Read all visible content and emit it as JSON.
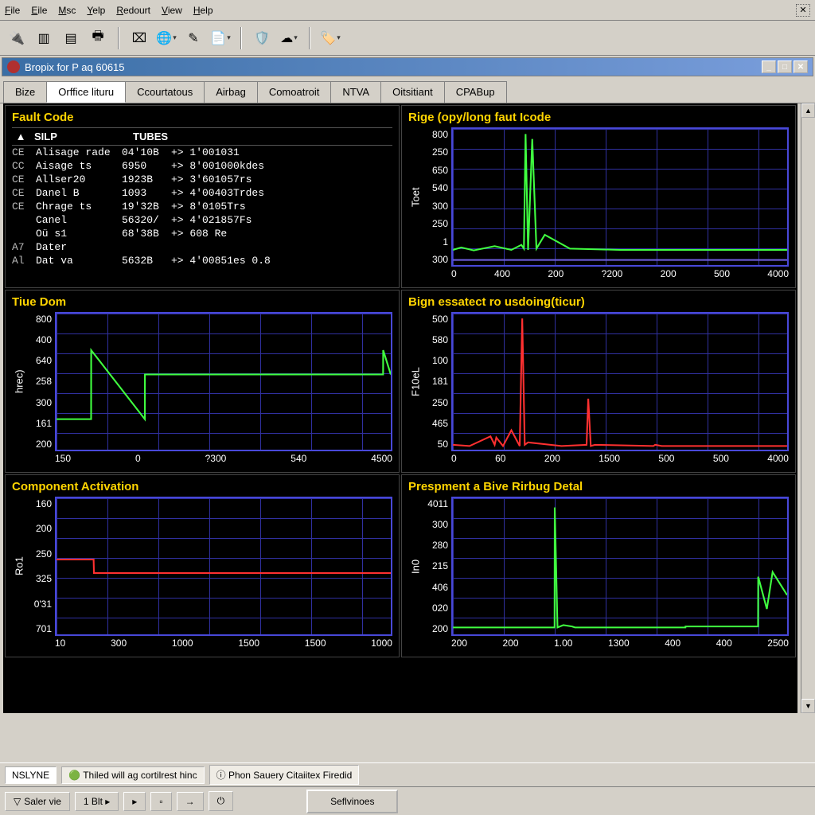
{
  "menu": {
    "file": "File",
    "eile": "Eile",
    "msc": "Msc",
    "yelp": "Yelp",
    "redout": "Redourt",
    "view": "View",
    "help": "Help"
  },
  "child_window_title": "Bropix for P aq 60615",
  "tabs": [
    "Bize",
    "Orffice lituru",
    "Ccourtatous",
    "Airbag",
    "Comoatroit",
    "NTVA",
    "Oitsitiant",
    "CPABup"
  ],
  "active_tab_index": 1,
  "fault_code": {
    "title": "Fault Code",
    "columns": {
      "a": "▲",
      "b": "SILP",
      "c": "TUBES"
    },
    "rows": [
      {
        "c0": "CE",
        "c1": "Alisage rade",
        "c2": "04'10B",
        "c3": "+> 1'001031"
      },
      {
        "c0": "CC",
        "c1": "Aisage ts",
        "c2": "6950",
        "c3": "+> 8'001000kdes"
      },
      {
        "c0": "CE",
        "c1": "Allser20",
        "c2": "1923B",
        "c3": "+> 3'601057rs"
      },
      {
        "c0": "CE",
        "c1": "Danel B",
        "c2": "1093",
        "c3": "+> 4'00403Trdes"
      },
      {
        "c0": "CE",
        "c1": "Chrage ts",
        "c2": "19'32B",
        "c3": "+> 8'0105Trs"
      },
      {
        "c0": "",
        "c1": "Canel",
        "c2": "56320/",
        "c3": "+> 4'021857Fs"
      },
      {
        "c0": "",
        "c1": "Oü s1",
        "c2": "68'38B",
        "c3": "+> 608 Re"
      },
      {
        "c0": "A7",
        "c1": "Dater",
        "c2": "",
        "c3": ""
      },
      {
        "c0": "Al",
        "c1": "Dat va",
        "c2": "5632B",
        "c3": "+> 4'00851es 0.8"
      }
    ]
  },
  "chart_data": [
    {
      "id": "rige",
      "title": "Rige (opy/long faut Icode",
      "type": "line",
      "ylabel": "Toet",
      "yticks": [
        "800",
        "250",
        "650",
        "540",
        "300",
        "250",
        "1",
        "300"
      ],
      "xticks": [
        "0",
        "400",
        "200",
        "?200",
        "200",
        "500",
        "4000"
      ],
      "series": [
        {
          "name": "A",
          "color": "#40ff40",
          "x": [
            0,
            100,
            250,
            500,
            700,
            820,
            850,
            870,
            900,
            950,
            1000,
            1100,
            1400,
            2000,
            3000,
            4000
          ],
          "y": [
            340,
            350,
            338,
            355,
            340,
            360,
            345,
            800,
            340,
            780,
            345,
            400,
            345,
            340,
            340,
            340
          ]
        },
        {
          "name": "B",
          "color": "#7060e0",
          "x": [
            0,
            4000
          ],
          "y": [
            300,
            300
          ]
        }
      ],
      "xlim": [
        0,
        4000
      ],
      "ylim": [
        280,
        820
      ]
    },
    {
      "id": "tiue",
      "title": "Tiue Dom",
      "type": "line",
      "ylabel": "hrec)",
      "yticks": [
        "800",
        "400",
        "640",
        "258",
        "300",
        "161",
        "200"
      ],
      "xticks": [
        "150",
        "0",
        "?300",
        "540",
        "4500"
      ],
      "series": [
        {
          "name": "A",
          "color": "#40ff40",
          "x": [
            150,
            600,
            601,
            1300,
            1301,
            4400,
            4401,
            4500
          ],
          "y": [
            300,
            300,
            640,
            300,
            520,
            520,
            640,
            520
          ]
        }
      ],
      "xlim": [
        150,
        4500
      ],
      "ylim": [
        150,
        820
      ]
    },
    {
      "id": "bign",
      "title": "Bign essatect ro usdoing(ticur)",
      "type": "line",
      "ylabel": "F10eL",
      "yticks": [
        "500",
        "580",
        "100",
        "181",
        "250",
        "465",
        "50"
      ],
      "xticks": [
        "0",
        "60",
        "200",
        "1500",
        "500",
        "500",
        "4000"
      ],
      "series": [
        {
          "name": "A",
          "color": "#ff3030",
          "x": [
            0,
            200,
            450,
            500,
            520,
            600,
            700,
            800,
            830,
            860,
            900,
            1300,
            1600,
            1620,
            1650,
            1700,
            2400,
            2420,
            2500,
            4000
          ],
          "y": [
            60,
            55,
            95,
            60,
            90,
            55,
            120,
            55,
            580,
            60,
            70,
            55,
            60,
            250,
            55,
            60,
            55,
            60,
            55,
            55
          ]
        }
      ],
      "xlim": [
        0,
        4000
      ],
      "ylim": [
        40,
        600
      ]
    },
    {
      "id": "comp",
      "title": "Component Activation",
      "type": "line",
      "ylabel": "Ro1",
      "yticks": [
        "160",
        "200",
        "250",
        "325",
        "0'31",
        "701"
      ],
      "xticks": [
        "10",
        "300",
        "1000",
        "1500",
        "1500",
        "1000"
      ],
      "series": [
        {
          "name": "A",
          "color": "#ff3030",
          "x": [
            10,
            120,
            121,
            1000
          ],
          "y": [
            260,
            260,
            240,
            240
          ]
        }
      ],
      "xlim": [
        10,
        1000
      ],
      "ylim": [
        150,
        350
      ]
    },
    {
      "id": "pres",
      "title": "Prespment a Bive Rirbug Detal",
      "type": "line",
      "ylabel": "In0",
      "yticks": [
        "4011",
        "300",
        "280",
        "215",
        "406",
        "020",
        "200"
      ],
      "xticks": [
        "200",
        "200",
        "1.00",
        "1300",
        "400",
        "400",
        "2500"
      ],
      "series": [
        {
          "name": "A",
          "color": "#40ff40",
          "x": [
            200,
            900,
            901,
            920,
            960,
            1020,
            1040,
            1800,
            1801,
            2300,
            2301,
            2360,
            2400,
            2500
          ],
          "y": [
            30,
            30,
            290,
            30,
            35,
            32,
            30,
            30,
            32,
            32,
            140,
            70,
            150,
            100
          ]
        }
      ],
      "xlim": [
        200,
        2500
      ],
      "ylim": [
        15,
        310
      ]
    }
  ],
  "status": {
    "seg1": "NSLYNE",
    "seg2": "Thiled will ag cortilrest hinc",
    "seg3": "Phon Sauery Citaiitex Firedid"
  },
  "bottom": {
    "b1": "Saler vie",
    "b2": "1 Blt ▸",
    "services": "Seflvinoes"
  }
}
